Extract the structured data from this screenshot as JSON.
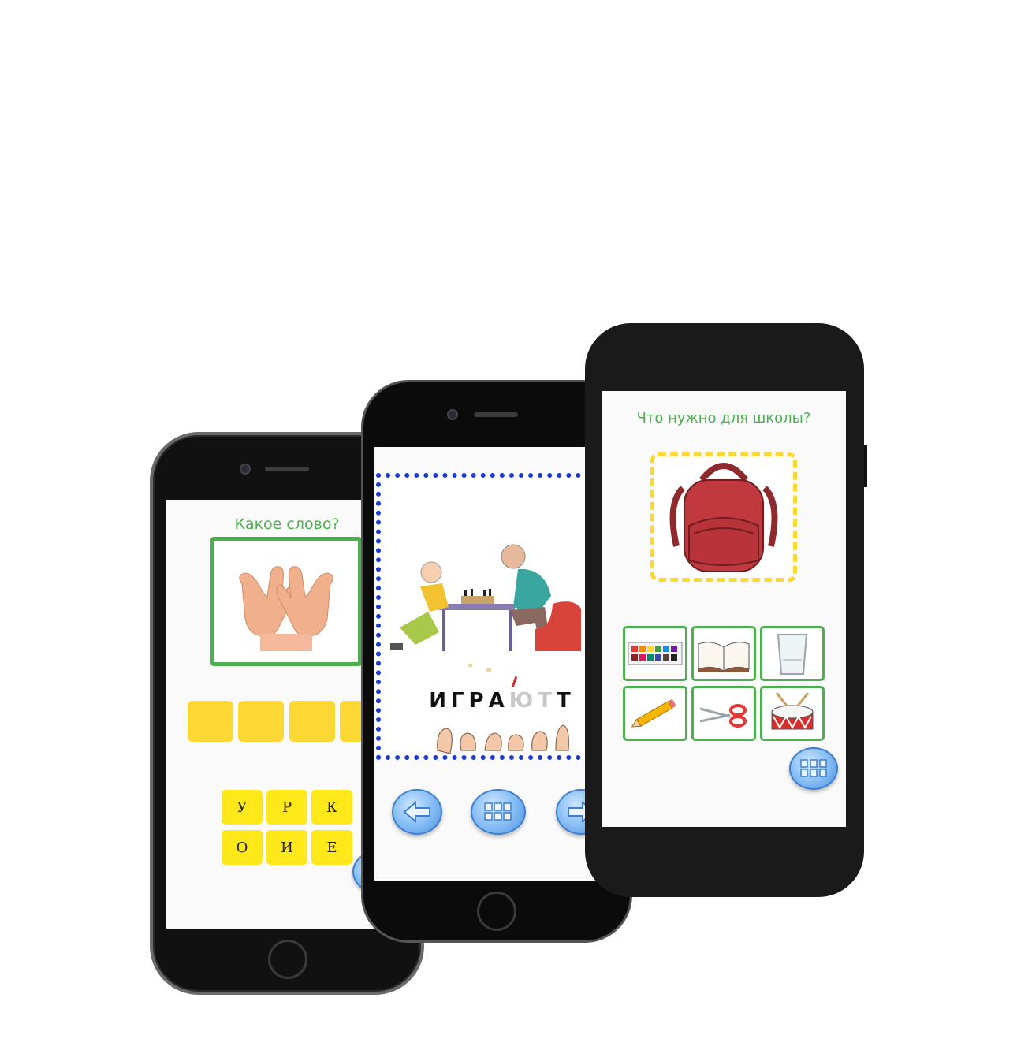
{
  "left_screen": {
    "question": "Какое слово?",
    "image_icon": "hands-photo",
    "answer_slots": 4,
    "letters_row1": [
      "У",
      "Р",
      "К"
    ],
    "letters_row2": [
      "О",
      "И",
      "Е"
    ],
    "menu_icon": "grid-icon"
  },
  "middle_screen": {
    "word_part1": "ИГРА",
    "word_part2": "ЮТ",
    "word_part3": "Т",
    "stress_mark": "ʹ",
    "image_icon": "chess-players-illustration",
    "sign_icon": "sign-language-hands",
    "nav": {
      "prev_icon": "arrow-left-icon",
      "menu_icon": "grid-icon",
      "next_icon": "arrow-right-icon"
    }
  },
  "right_screen": {
    "question": "Что нужно для школы?",
    "main_image": "backpack",
    "choices": [
      "watercolor-paints",
      "open-book",
      "glass",
      "pencil",
      "scissors",
      "drum"
    ],
    "menu_icon": "grid-icon"
  },
  "colors": {
    "accent_green": "#4caf50",
    "tile_yellow": "#fdd835",
    "frame_blue": "#1a3ad6",
    "button_blue": "#4c93e0"
  }
}
